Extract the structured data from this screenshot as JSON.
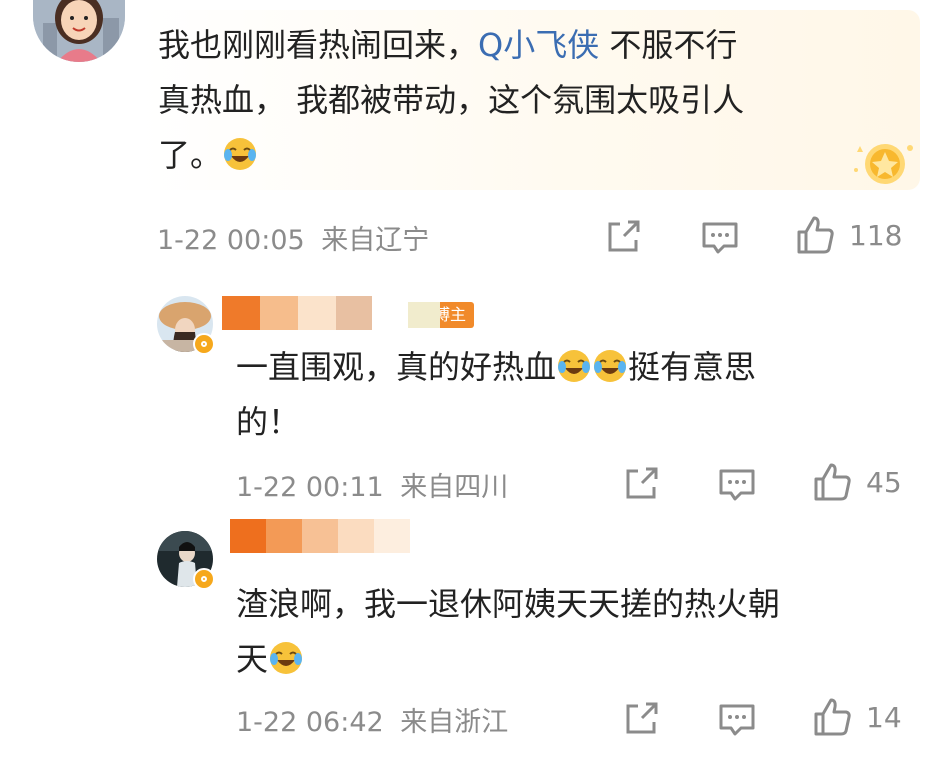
{
  "comments": [
    {
      "mention": "Q小飞侠",
      "text_before": "我也刚刚看热闹回来，",
      "text_after_line1": " 不服不行",
      "text_line2": "真热血， 我都被带动，这个氛围太吸引人",
      "text_line3": "了。",
      "time": "1-22 00:05",
      "location": "来自辽宁",
      "likes": "118"
    },
    {
      "host_tag": "博主",
      "text_line1": "一直围观，真的好热血",
      "text_line1_after": "挺有意思",
      "text_line2": "的！",
      "time": "1-22 00:11",
      "location": "来自四川",
      "likes": "45"
    },
    {
      "text_line1": "渣浪啊，我一退休阿姨天天搓的热火朝",
      "text_line2": "天",
      "time": "1-22 06:42",
      "location": "来自浙江",
      "likes": "14"
    }
  ],
  "icons": [
    "share-icon",
    "comment-icon",
    "like-icon",
    "laugh-cry-emoji",
    "medal-icon",
    "verified-badge-icon"
  ],
  "colors": {
    "mention": "#3b6db2",
    "meta": "#8b8b8b",
    "text": "#222222",
    "badge": "#f6a81c",
    "host_tag": "#f18a2a"
  }
}
